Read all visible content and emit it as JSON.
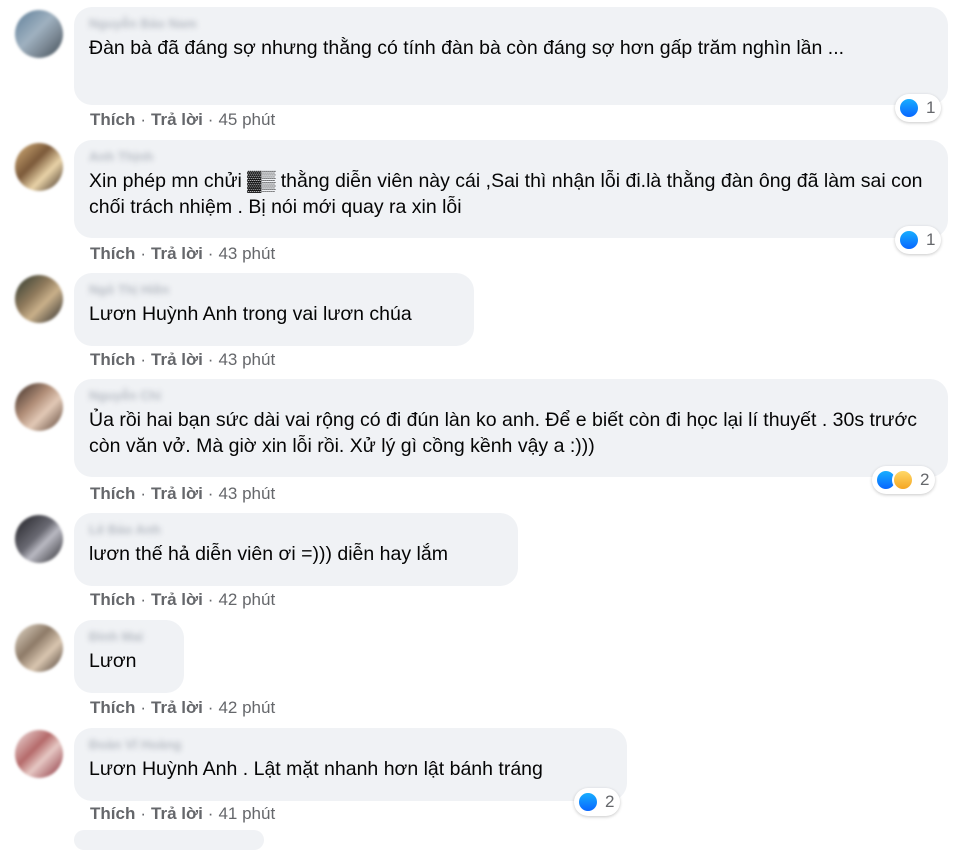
{
  "actions": {
    "like": "Thích",
    "reply": "Trả lời",
    "separator": "·"
  },
  "comments": [
    {
      "author": "Nguyễn Bảo Nam",
      "text": "Đàn bà đã đáng sợ nhưng thằng có tính đàn bà còn đáng sợ hơn gấp trăm nghìn lần ...",
      "time": "45 phút",
      "reaction_count": "1",
      "reactions": [
        "like-icon"
      ]
    },
    {
      "author": "Anh Thịnh",
      "text": "Xin phép mn chửi ▓▒ thằng diễn viên này cái ,Sai thì nhận lỗi đi.là thằng đàn ông đã làm sai con chối trách nhiệm . Bị nói mới quay ra xin lỗi",
      "time": "43 phút",
      "reaction_count": "1",
      "reactions": [
        "like-icon"
      ]
    },
    {
      "author": "Ngô Thị Hiền",
      "text": "Lươn Huỳnh Anh trong vai lươn chúa",
      "time": "43 phút",
      "reaction_count": "",
      "reactions": []
    },
    {
      "author": "Nguyễn Chi",
      "text": "Ủa rồi hai bạn sức dài vai rộng có đi đún làn ko anh. Để e biết còn đi học lại lí thuyết . 30s trước còn văn vở. Mà giờ xin lỗi rồi. Xử lý gì cồng kềnh vậy a :)))",
      "time": "43 phút",
      "reaction_count": "2",
      "reactions": [
        "like-icon",
        "haha-icon"
      ]
    },
    {
      "author": "Lê Bảo Anh",
      "text": "lươn thế hả diễn viên ơi =))) diễn hay lắm",
      "time": "42 phút",
      "reaction_count": "",
      "reactions": []
    },
    {
      "author": "Đinh Mai",
      "text": "Lươn",
      "time": "42 phút",
      "reaction_count": "",
      "reactions": []
    },
    {
      "author": "Đoàn Vĩ Hoàng",
      "text": "Lươn Huỳnh Anh . Lật mặt nhanh hơn lật bánh tráng",
      "time": "41 phút",
      "reaction_count": "2",
      "reactions": [
        "like-icon"
      ]
    }
  ],
  "colors": {
    "bubble": "#f0f2f5",
    "text": "#050505",
    "meta": "#65676b",
    "like": "#0866ff",
    "haha": "#f7b125"
  }
}
